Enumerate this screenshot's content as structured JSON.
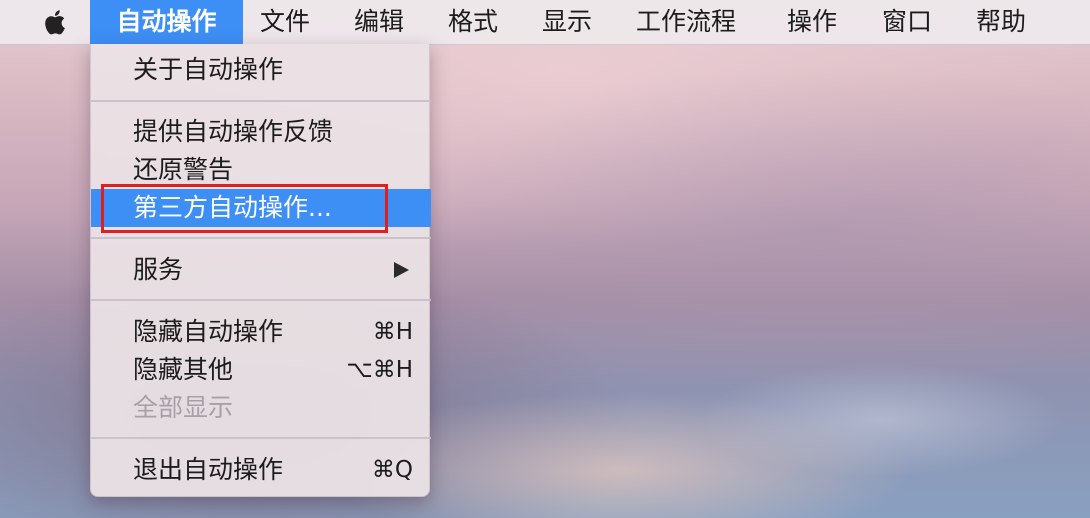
{
  "menubar": {
    "apple_icon": "apple-logo-icon",
    "items": [
      "自动操作",
      "文件",
      "编辑",
      "格式",
      "显示",
      "工作流程",
      "操作",
      "窗口",
      "帮助"
    ],
    "active_item": "自动操作"
  },
  "menu": {
    "about": "关于自动操作",
    "feedback": "提供自动操作反馈",
    "restore_warnings": "还原警告",
    "third_party": "第三方自动操作...",
    "services": "服务",
    "hide_app": "隐藏自动操作",
    "hide_app_shortcut": "⌘H",
    "hide_others": "隐藏其他",
    "hide_others_shortcut": "⌥⌘H",
    "show_all": "全部显示",
    "quit": "退出自动操作",
    "quit_shortcut": "⌘Q"
  },
  "colors": {
    "highlight": "#3d8ff5",
    "annotation_box": "#e02020"
  }
}
